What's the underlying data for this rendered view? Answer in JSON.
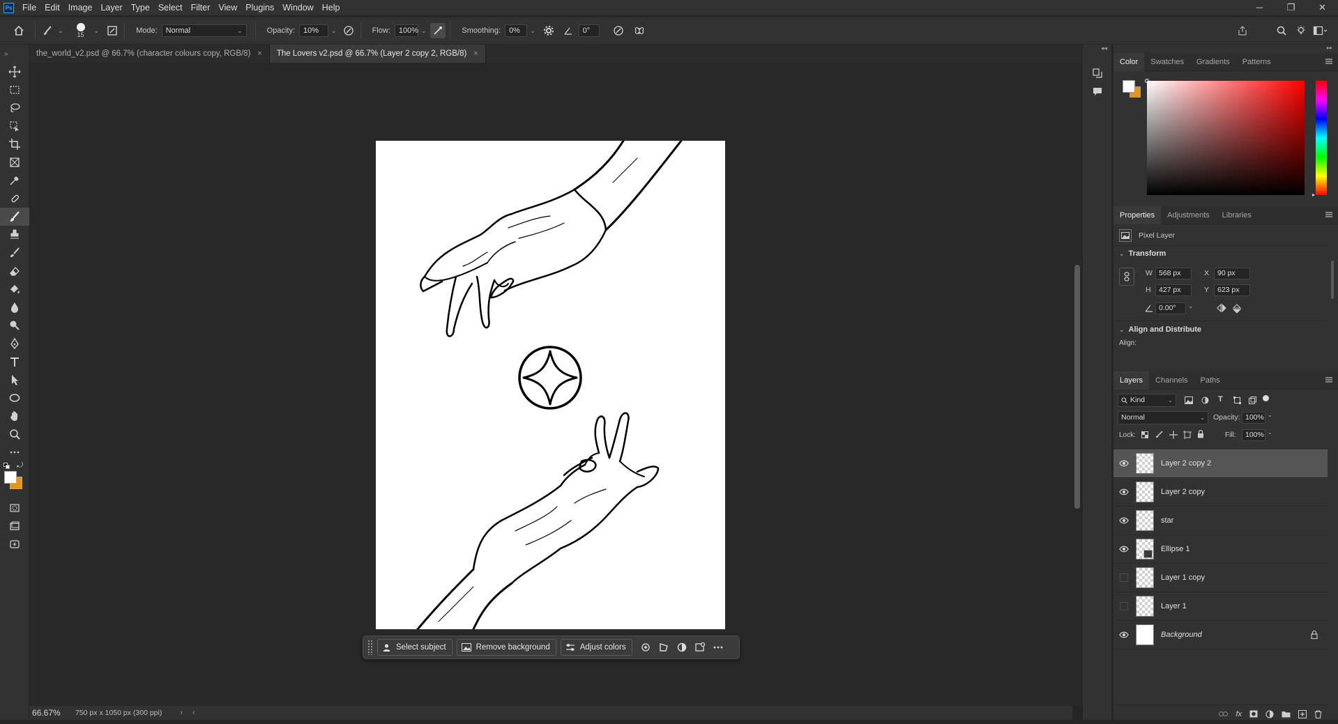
{
  "app": {
    "logo": "Ps",
    "menu": [
      "File",
      "Edit",
      "Image",
      "Layer",
      "Type",
      "Select",
      "Filter",
      "View",
      "Plugins",
      "Window",
      "Help"
    ]
  },
  "options_bar": {
    "brush_size": "15",
    "mode_label": "Mode:",
    "mode_value": "Normal",
    "opacity_label": "Opacity:",
    "opacity_value": "10%",
    "flow_label": "Flow:",
    "flow_value": "100%",
    "smoothing_label": "Smoothing:",
    "smoothing_value": "0%",
    "angle_value": "0°"
  },
  "tabs": [
    {
      "label": "the_world_v2.psd @ 66.7% (character colours copy, RGB/8)",
      "active": false
    },
    {
      "label": "The Lovers v2.psd @ 66.7% (Layer 2 copy 2, RGB/8)",
      "active": true
    }
  ],
  "tab_close_glyph": "×",
  "contextual_bar": {
    "select_subject": "Select subject",
    "remove_background": "Remove background",
    "adjust_colors": "Adjust colors"
  },
  "status": {
    "zoom": "66.67%",
    "doc_info": "750 px x 1050 px (300 ppi)"
  },
  "color_panel": {
    "tabs": [
      "Color",
      "Swatches",
      "Gradients",
      "Patterns"
    ],
    "foreground": "#ffffff",
    "background": "#e8941a",
    "hue_color": "#ff0000"
  },
  "properties_panel": {
    "tabs": [
      "Properties",
      "Adjustments",
      "Libraries"
    ],
    "layer_type": "Pixel Layer",
    "transform_title": "Transform",
    "w_label": "W",
    "w_value": "568 px",
    "h_label": "H",
    "h_value": "427 px",
    "x_label": "X",
    "x_value": "90 px",
    "y_label": "Y",
    "y_value": "623 px",
    "angle_value": "0.00°",
    "align_title": "Align and Distribute",
    "align_label": "Align:"
  },
  "layers_panel": {
    "tabs": [
      "Layers",
      "Channels",
      "Paths"
    ],
    "filter_value": "Kind",
    "blend_mode": "Normal",
    "opacity_label": "Opacity:",
    "opacity_value": "100%",
    "lock_label": "Lock:",
    "fill_label": "Fill:",
    "fill_value": "100%",
    "layers": [
      {
        "name": "Layer 2 copy 2",
        "visible": true,
        "selected": true,
        "thumb": "transparent"
      },
      {
        "name": "Layer 2 copy",
        "visible": true,
        "selected": false,
        "thumb": "transparent"
      },
      {
        "name": "star",
        "visible": true,
        "selected": false,
        "thumb": "transparent"
      },
      {
        "name": "Ellipse 1",
        "visible": true,
        "selected": false,
        "thumb": "shape"
      },
      {
        "name": "Layer 1 copy",
        "visible": false,
        "selected": false,
        "thumb": "transparent"
      },
      {
        "name": "Layer 1",
        "visible": false,
        "selected": false,
        "thumb": "transparent"
      },
      {
        "name": "Background",
        "visible": true,
        "selected": false,
        "thumb": "white",
        "italic": true,
        "locked": true
      }
    ]
  }
}
